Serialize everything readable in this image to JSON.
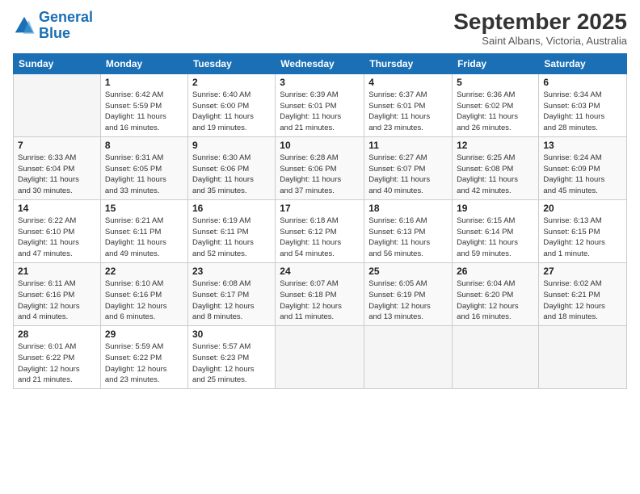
{
  "header": {
    "logo_line1": "General",
    "logo_line2": "Blue",
    "title": "September 2025",
    "subtitle": "Saint Albans, Victoria, Australia"
  },
  "days_of_week": [
    "Sunday",
    "Monday",
    "Tuesday",
    "Wednesday",
    "Thursday",
    "Friday",
    "Saturday"
  ],
  "weeks": [
    [
      {
        "day": "",
        "info": ""
      },
      {
        "day": "1",
        "info": "Sunrise: 6:42 AM\nSunset: 5:59 PM\nDaylight: 11 hours\nand 16 minutes."
      },
      {
        "day": "2",
        "info": "Sunrise: 6:40 AM\nSunset: 6:00 PM\nDaylight: 11 hours\nand 19 minutes."
      },
      {
        "day": "3",
        "info": "Sunrise: 6:39 AM\nSunset: 6:01 PM\nDaylight: 11 hours\nand 21 minutes."
      },
      {
        "day": "4",
        "info": "Sunrise: 6:37 AM\nSunset: 6:01 PM\nDaylight: 11 hours\nand 23 minutes."
      },
      {
        "day": "5",
        "info": "Sunrise: 6:36 AM\nSunset: 6:02 PM\nDaylight: 11 hours\nand 26 minutes."
      },
      {
        "day": "6",
        "info": "Sunrise: 6:34 AM\nSunset: 6:03 PM\nDaylight: 11 hours\nand 28 minutes."
      }
    ],
    [
      {
        "day": "7",
        "info": "Sunrise: 6:33 AM\nSunset: 6:04 PM\nDaylight: 11 hours\nand 30 minutes."
      },
      {
        "day": "8",
        "info": "Sunrise: 6:31 AM\nSunset: 6:05 PM\nDaylight: 11 hours\nand 33 minutes."
      },
      {
        "day": "9",
        "info": "Sunrise: 6:30 AM\nSunset: 6:06 PM\nDaylight: 11 hours\nand 35 minutes."
      },
      {
        "day": "10",
        "info": "Sunrise: 6:28 AM\nSunset: 6:06 PM\nDaylight: 11 hours\nand 37 minutes."
      },
      {
        "day": "11",
        "info": "Sunrise: 6:27 AM\nSunset: 6:07 PM\nDaylight: 11 hours\nand 40 minutes."
      },
      {
        "day": "12",
        "info": "Sunrise: 6:25 AM\nSunset: 6:08 PM\nDaylight: 11 hours\nand 42 minutes."
      },
      {
        "day": "13",
        "info": "Sunrise: 6:24 AM\nSunset: 6:09 PM\nDaylight: 11 hours\nand 45 minutes."
      }
    ],
    [
      {
        "day": "14",
        "info": "Sunrise: 6:22 AM\nSunset: 6:10 PM\nDaylight: 11 hours\nand 47 minutes."
      },
      {
        "day": "15",
        "info": "Sunrise: 6:21 AM\nSunset: 6:11 PM\nDaylight: 11 hours\nand 49 minutes."
      },
      {
        "day": "16",
        "info": "Sunrise: 6:19 AM\nSunset: 6:11 PM\nDaylight: 11 hours\nand 52 minutes."
      },
      {
        "day": "17",
        "info": "Sunrise: 6:18 AM\nSunset: 6:12 PM\nDaylight: 11 hours\nand 54 minutes."
      },
      {
        "day": "18",
        "info": "Sunrise: 6:16 AM\nSunset: 6:13 PM\nDaylight: 11 hours\nand 56 minutes."
      },
      {
        "day": "19",
        "info": "Sunrise: 6:15 AM\nSunset: 6:14 PM\nDaylight: 11 hours\nand 59 minutes."
      },
      {
        "day": "20",
        "info": "Sunrise: 6:13 AM\nSunset: 6:15 PM\nDaylight: 12 hours\nand 1 minute."
      }
    ],
    [
      {
        "day": "21",
        "info": "Sunrise: 6:11 AM\nSunset: 6:16 PM\nDaylight: 12 hours\nand 4 minutes."
      },
      {
        "day": "22",
        "info": "Sunrise: 6:10 AM\nSunset: 6:16 PM\nDaylight: 12 hours\nand 6 minutes."
      },
      {
        "day": "23",
        "info": "Sunrise: 6:08 AM\nSunset: 6:17 PM\nDaylight: 12 hours\nand 8 minutes."
      },
      {
        "day": "24",
        "info": "Sunrise: 6:07 AM\nSunset: 6:18 PM\nDaylight: 12 hours\nand 11 minutes."
      },
      {
        "day": "25",
        "info": "Sunrise: 6:05 AM\nSunset: 6:19 PM\nDaylight: 12 hours\nand 13 minutes."
      },
      {
        "day": "26",
        "info": "Sunrise: 6:04 AM\nSunset: 6:20 PM\nDaylight: 12 hours\nand 16 minutes."
      },
      {
        "day": "27",
        "info": "Sunrise: 6:02 AM\nSunset: 6:21 PM\nDaylight: 12 hours\nand 18 minutes."
      }
    ],
    [
      {
        "day": "28",
        "info": "Sunrise: 6:01 AM\nSunset: 6:22 PM\nDaylight: 12 hours\nand 21 minutes."
      },
      {
        "day": "29",
        "info": "Sunrise: 5:59 AM\nSunset: 6:22 PM\nDaylight: 12 hours\nand 23 minutes."
      },
      {
        "day": "30",
        "info": "Sunrise: 5:57 AM\nSunset: 6:23 PM\nDaylight: 12 hours\nand 25 minutes."
      },
      {
        "day": "",
        "info": ""
      },
      {
        "day": "",
        "info": ""
      },
      {
        "day": "",
        "info": ""
      },
      {
        "day": "",
        "info": ""
      }
    ]
  ]
}
